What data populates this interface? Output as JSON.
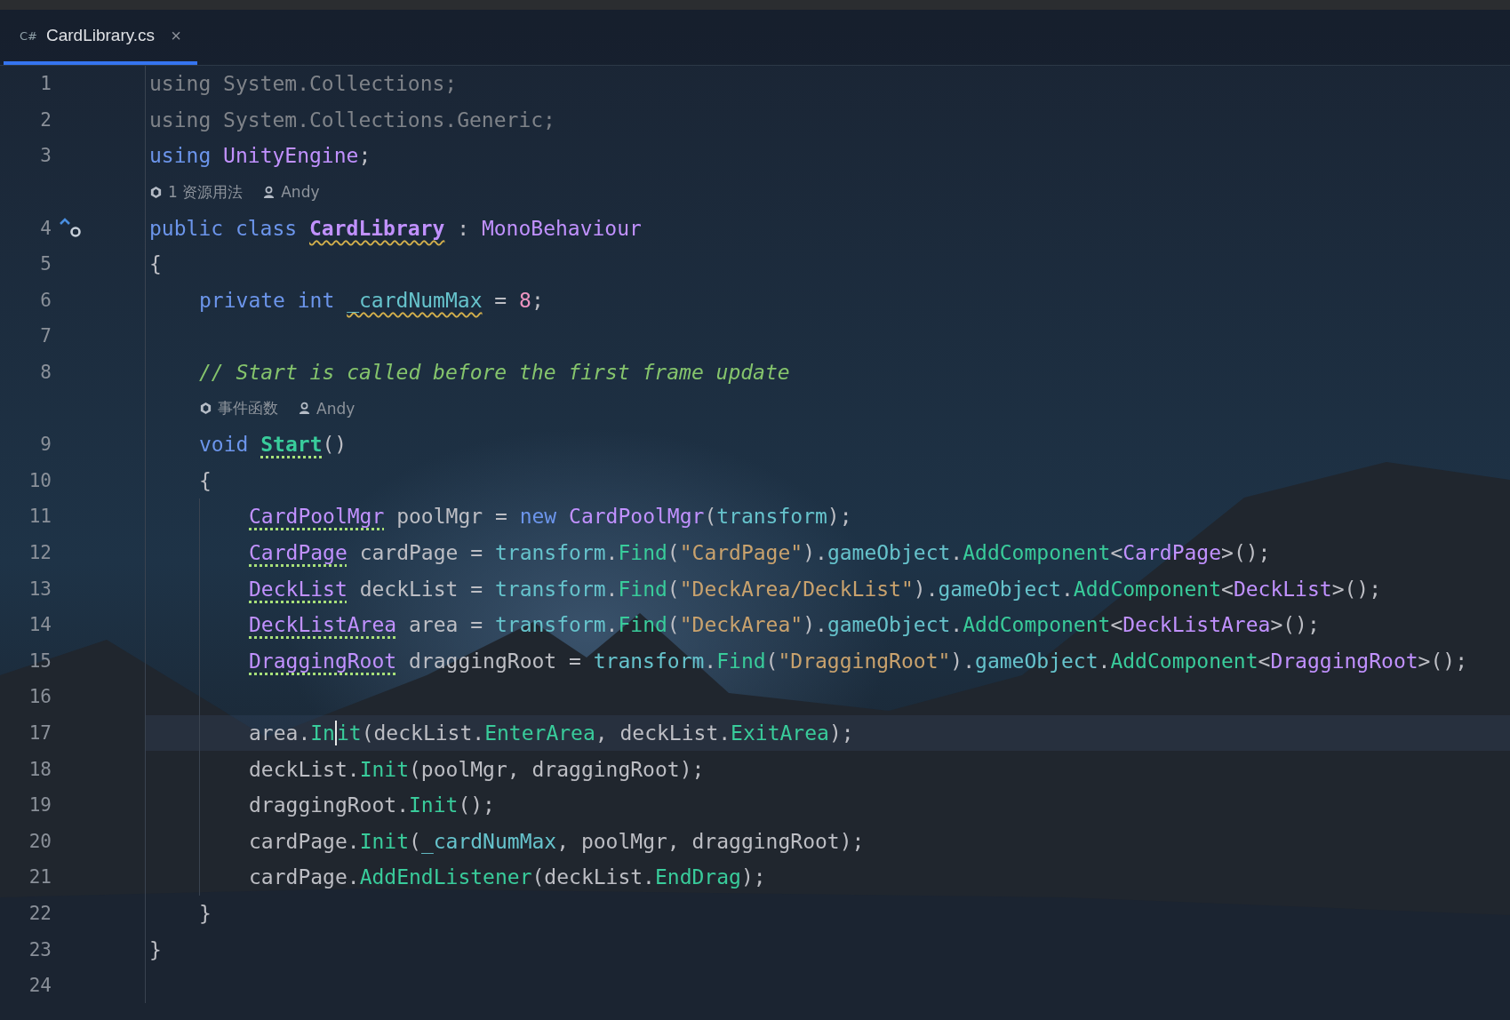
{
  "tabs": [
    {
      "file_icon": "C#",
      "title": "CardLibrary.cs",
      "close": "×",
      "selected": true
    }
  ],
  "rows": [
    {
      "kind": "code",
      "number": "1",
      "tokens": [
        {
          "text": "using System.Collections;",
          "kind": "unused"
        }
      ]
    },
    {
      "kind": "code",
      "number": "2",
      "tokens": [
        {
          "text": "using System.Collections.Generic;",
          "kind": "unused"
        }
      ]
    },
    {
      "kind": "code",
      "number": "3",
      "tokens": [
        {
          "text": "using ",
          "kind": "keyword"
        },
        {
          "text": "UnityEngine",
          "kind": "type"
        },
        {
          "text": ";",
          "kind": "plain"
        }
      ]
    },
    {
      "kind": "hint",
      "items": [
        {
          "kind": "usages",
          "text": "1 资源用法"
        },
        {
          "kind": "author",
          "text": "Andy"
        }
      ]
    },
    {
      "kind": "code",
      "number": "4",
      "marker": true,
      "tokens": [
        {
          "text": "public class ",
          "kind": "keyword"
        },
        {
          "text": "CardLibrary",
          "kind": "type",
          "bold": true,
          "wavy_underline": true
        },
        {
          "text": " : ",
          "kind": "plain"
        },
        {
          "text": "MonoBehaviour",
          "kind": "type"
        }
      ]
    },
    {
      "kind": "code",
      "number": "5",
      "tokens": [
        {
          "text": "{",
          "kind": "plain"
        }
      ],
      "children": [
        {
          "kind": "code",
          "number": "6",
          "tokens": [
            {
              "text": "private int ",
              "kind": "keyword"
            },
            {
              "text": "_cardNumMax",
              "kind": "field",
              "wavy_underline": true
            },
            {
              "text": " = ",
              "kind": "plain"
            },
            {
              "text": "8",
              "kind": "number"
            },
            {
              "text": ";",
              "kind": "plain"
            }
          ]
        },
        {
          "kind": "code",
          "number": "7"
        },
        {
          "kind": "code",
          "number": "8",
          "tokens": [
            {
              "text": "// Start is called before the first frame update",
              "kind": "comment"
            }
          ]
        },
        {
          "kind": "hint",
          "items": [
            {
              "kind": "usages",
              "text": "事件函数"
            },
            {
              "kind": "author",
              "text": "Andy"
            }
          ]
        },
        {
          "kind": "code",
          "number": "9",
          "tokens": [
            {
              "text": "void ",
              "kind": "keyword"
            },
            {
              "text": "Start",
              "kind": "method",
              "bold": true,
              "dotted_underline": true
            },
            {
              "text": "()",
              "kind": "plain"
            }
          ]
        },
        {
          "kind": "code",
          "number": "10",
          "tokens": [
            {
              "text": "{",
              "kind": "plain"
            }
          ],
          "children": [
            {
              "kind": "code",
              "number": "11",
              "tokens": [
                {
                  "text": "CardPoolMgr",
                  "kind": "type",
                  "dotted_underline": true
                },
                {
                  "text": " poolMgr = ",
                  "kind": "plain"
                },
                {
                  "text": "new ",
                  "kind": "keyword"
                },
                {
                  "text": "CardPoolMgr",
                  "kind": "type"
                },
                {
                  "text": "(",
                  "kind": "plain"
                },
                {
                  "text": "transform",
                  "kind": "field"
                },
                {
                  "text": ");",
                  "kind": "plain"
                }
              ]
            },
            {
              "kind": "code",
              "number": "12",
              "tokens": [
                {
                  "text": "CardPage",
                  "kind": "type",
                  "dotted_underline": true
                },
                {
                  "text": " cardPage = ",
                  "kind": "plain"
                },
                {
                  "text": "transform",
                  "kind": "field"
                },
                {
                  "text": ".",
                  "kind": "plain"
                },
                {
                  "text": "Find",
                  "kind": "method"
                },
                {
                  "text": "(",
                  "kind": "plain"
                },
                {
                  "text": "\"CardPage\"",
                  "kind": "string"
                },
                {
                  "text": ").",
                  "kind": "plain"
                },
                {
                  "text": "gameObject",
                  "kind": "field"
                },
                {
                  "text": ".",
                  "kind": "plain"
                },
                {
                  "text": "AddComponent",
                  "kind": "method"
                },
                {
                  "text": "<",
                  "kind": "plain"
                },
                {
                  "text": "CardPage",
                  "kind": "type"
                },
                {
                  "text": ">();",
                  "kind": "plain"
                }
              ]
            },
            {
              "kind": "code",
              "number": "13",
              "tokens": [
                {
                  "text": "DeckList",
                  "kind": "type",
                  "dotted_underline": true
                },
                {
                  "text": " deckList = ",
                  "kind": "plain"
                },
                {
                  "text": "transform",
                  "kind": "field"
                },
                {
                  "text": ".",
                  "kind": "plain"
                },
                {
                  "text": "Find",
                  "kind": "method"
                },
                {
                  "text": "(",
                  "kind": "plain"
                },
                {
                  "text": "\"DeckArea/DeckList\"",
                  "kind": "string"
                },
                {
                  "text": ").",
                  "kind": "plain"
                },
                {
                  "text": "gameObject",
                  "kind": "field"
                },
                {
                  "text": ".",
                  "kind": "plain"
                },
                {
                  "text": "AddComponent",
                  "kind": "method"
                },
                {
                  "text": "<",
                  "kind": "plain"
                },
                {
                  "text": "DeckList",
                  "kind": "type"
                },
                {
                  "text": ">();",
                  "kind": "plain"
                }
              ]
            },
            {
              "kind": "code",
              "number": "14",
              "tokens": [
                {
                  "text": "DeckListArea",
                  "kind": "type",
                  "dotted_underline": true
                },
                {
                  "text": " area = ",
                  "kind": "plain"
                },
                {
                  "text": "transform",
                  "kind": "field"
                },
                {
                  "text": ".",
                  "kind": "plain"
                },
                {
                  "text": "Find",
                  "kind": "method"
                },
                {
                  "text": "(",
                  "kind": "plain"
                },
                {
                  "text": "\"DeckArea\"",
                  "kind": "string"
                },
                {
                  "text": ").",
                  "kind": "plain"
                },
                {
                  "text": "gameObject",
                  "kind": "field"
                },
                {
                  "text": ".",
                  "kind": "plain"
                },
                {
                  "text": "AddComponent",
                  "kind": "method"
                },
                {
                  "text": "<",
                  "kind": "plain"
                },
                {
                  "text": "DeckListArea",
                  "kind": "type"
                },
                {
                  "text": ">();",
                  "kind": "plain"
                }
              ]
            },
            {
              "kind": "code",
              "number": "15",
              "tokens": [
                {
                  "text": "DraggingRoot",
                  "kind": "type",
                  "dotted_underline": true
                },
                {
                  "text": " draggingRoot = ",
                  "kind": "plain"
                },
                {
                  "text": "transform",
                  "kind": "field"
                },
                {
                  "text": ".",
                  "kind": "plain"
                },
                {
                  "text": "Find",
                  "kind": "method"
                },
                {
                  "text": "(",
                  "kind": "plain"
                },
                {
                  "text": "\"DraggingRoot\"",
                  "kind": "string"
                },
                {
                  "text": ").",
                  "kind": "plain"
                },
                {
                  "text": "gameObject",
                  "kind": "field"
                },
                {
                  "text": ".",
                  "kind": "plain"
                },
                {
                  "text": "AddComponent",
                  "kind": "method"
                },
                {
                  "text": "<",
                  "kind": "plain"
                },
                {
                  "text": "DraggingRoot",
                  "kind": "type"
                },
                {
                  "text": ">();",
                  "kind": "plain"
                }
              ]
            },
            {
              "kind": "code",
              "number": "16"
            },
            {
              "kind": "code",
              "number": "17",
              "current": true,
              "tokens": [
                {
                  "text": "area.",
                  "kind": "plain"
                },
                {
                  "text": "In",
                  "kind": "method",
                  "caret_after": true
                },
                {
                  "text": "it",
                  "kind": "method"
                },
                {
                  "text": "(deckList.",
                  "kind": "plain"
                },
                {
                  "text": "EnterArea",
                  "kind": "method"
                },
                {
                  "text": ", deckList.",
                  "kind": "plain"
                },
                {
                  "text": "ExitArea",
                  "kind": "method"
                },
                {
                  "text": ");",
                  "kind": "plain"
                }
              ]
            },
            {
              "kind": "code",
              "number": "18",
              "tokens": [
                {
                  "text": "deckList.",
                  "kind": "plain"
                },
                {
                  "text": "Init",
                  "kind": "method"
                },
                {
                  "text": "(poolMgr, draggingRoot);",
                  "kind": "plain"
                }
              ]
            },
            {
              "kind": "code",
              "number": "19",
              "tokens": [
                {
                  "text": "draggingRoot.",
                  "kind": "plain"
                },
                {
                  "text": "Init",
                  "kind": "method"
                },
                {
                  "text": "();",
                  "kind": "plain"
                }
              ]
            },
            {
              "kind": "code",
              "number": "20",
              "tokens": [
                {
                  "text": "cardPage.",
                  "kind": "plain"
                },
                {
                  "text": "Init",
                  "kind": "method"
                },
                {
                  "text": "(",
                  "kind": "plain"
                },
                {
                  "text": "_cardNumMax",
                  "kind": "field"
                },
                {
                  "text": ", poolMgr, draggingRoot);",
                  "kind": "plain"
                }
              ]
            },
            {
              "kind": "code",
              "number": "21",
              "tokens": [
                {
                  "text": "cardPage.",
                  "kind": "plain"
                },
                {
                  "text": "AddEndListener",
                  "kind": "method"
                },
                {
                  "text": "(deckList.",
                  "kind": "plain"
                },
                {
                  "text": "EndDrag",
                  "kind": "method"
                },
                {
                  "text": ");",
                  "kind": "plain"
                }
              ]
            }
          ]
        },
        {
          "kind": "code",
          "number": "22",
          "tokens": [
            {
              "text": "}",
              "kind": "plain"
            }
          ]
        }
      ]
    },
    {
      "kind": "code",
      "number": "23",
      "tokens": [
        {
          "text": "}",
          "kind": "plain"
        }
      ]
    },
    {
      "kind": "code",
      "number": "24"
    }
  ]
}
